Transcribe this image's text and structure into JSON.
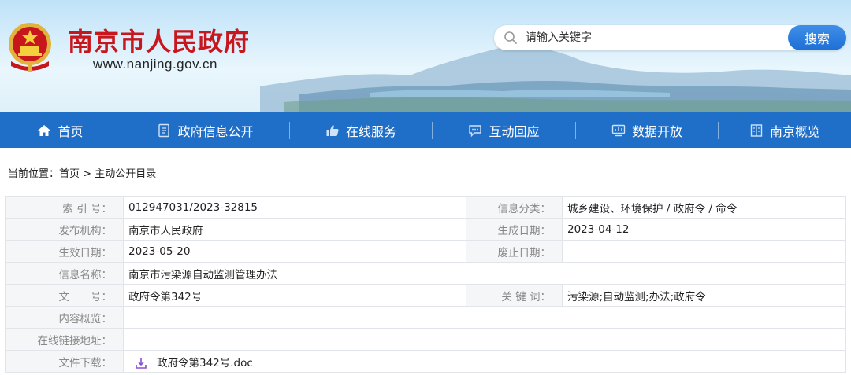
{
  "header": {
    "site_title": "南京市人民政府",
    "site_url": "www.nanjing.gov.cn",
    "search_placeholder": "请输入关键字",
    "search_button": "搜索"
  },
  "nav": [
    {
      "label": "首页",
      "icon": "home-icon"
    },
    {
      "label": "政府信息公开",
      "icon": "document-icon"
    },
    {
      "label": "在线服务",
      "icon": "thumbs-up-icon"
    },
    {
      "label": "互动回应",
      "icon": "chat-icon"
    },
    {
      "label": "数据开放",
      "icon": "data-screen-icon"
    },
    {
      "label": "南京概览",
      "icon": "building-icon"
    }
  ],
  "breadcrumb": {
    "prefix": "当前位置：",
    "home": "首页",
    "separator": " > ",
    "current": "主动公开目录"
  },
  "info": {
    "index_label": "索 引 号：",
    "index_value": "012947031/2023-32815",
    "category_label": "信息分类：",
    "category_value": "城乡建设、环境保护 / 政府令 / 命令",
    "publisher_label": "发布机构：",
    "publisher_value": "南京市人民政府",
    "created_label": "生成日期：",
    "created_value": "2023-04-12",
    "effective_label": "生效日期：",
    "effective_value": "2023-05-20",
    "abolished_label": "废止日期：",
    "abolished_value": "",
    "name_label": "信息名称：",
    "name_value": "南京市污染源自动监测管理办法",
    "docno_label": "文　　号：",
    "docno_value": "政府令第342号",
    "keywords_label": "关 键 词：",
    "keywords_value": "污染源;自动监测;办法;政府令",
    "summary_label": "内容概览：",
    "summary_value": "",
    "link_label": "在线链接地址：",
    "link_value": "",
    "download_label": "文件下载：",
    "download_file": "政府令第342号.doc"
  },
  "colors": {
    "title_red": "#c8161d",
    "nav_blue": "#1f6ec8",
    "search_blue": "#2f7fe0"
  }
}
